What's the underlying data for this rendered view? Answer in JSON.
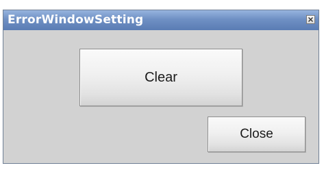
{
  "window": {
    "title": "ErrorWindowSetting",
    "close_icon": "close-icon"
  },
  "buttons": {
    "clear_label": "Clear",
    "close_label": "Close"
  },
  "colors": {
    "titlebar": "#6f90c4",
    "title_text": "#ffffff",
    "window_bg": "#d2d2d2",
    "button_text": "#1a1a1a"
  }
}
